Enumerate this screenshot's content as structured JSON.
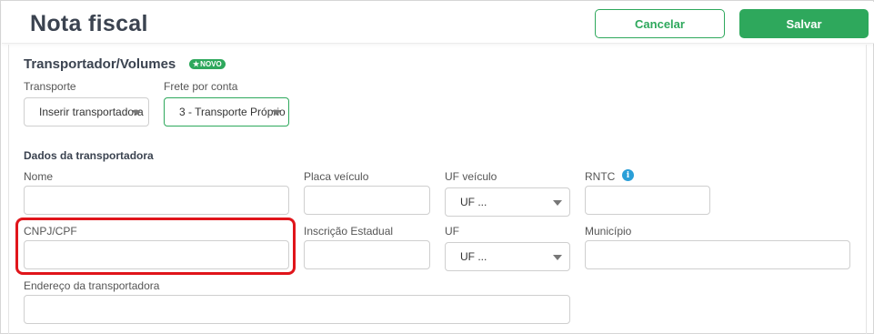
{
  "header": {
    "title": "Nota fiscal",
    "cancel_label": "Cancelar",
    "save_label": "Salvar"
  },
  "section": {
    "title": "Transportador/Volumes",
    "badge": "NOVO"
  },
  "transport": {
    "transporte_label": "Transporte",
    "transporte_value": "Inserir transportadora",
    "frete_label": "Frete por conta",
    "frete_value": "3 - Transporte Próprio"
  },
  "dados": {
    "title": "Dados da transportadora",
    "nome_label": "Nome",
    "placa_label": "Placa veículo",
    "uf_veiculo_label": "UF veículo",
    "uf_veiculo_value": "UF ...",
    "rntc_label": "RNTC",
    "cnpj_label": "CNPJ/CPF",
    "ie_label": "Inscrição Estadual",
    "uf_label": "UF",
    "uf_value": "UF ...",
    "municipio_label": "Município",
    "endereco_label": "Endereço da transportadora"
  },
  "colors": {
    "accent": "#2ea85c",
    "highlight": "#e0151b",
    "info": "#2a9fd8"
  },
  "icons": {
    "badge": "star-icon",
    "rntc_info": "info-icon",
    "select": "chevron-down-icon"
  }
}
